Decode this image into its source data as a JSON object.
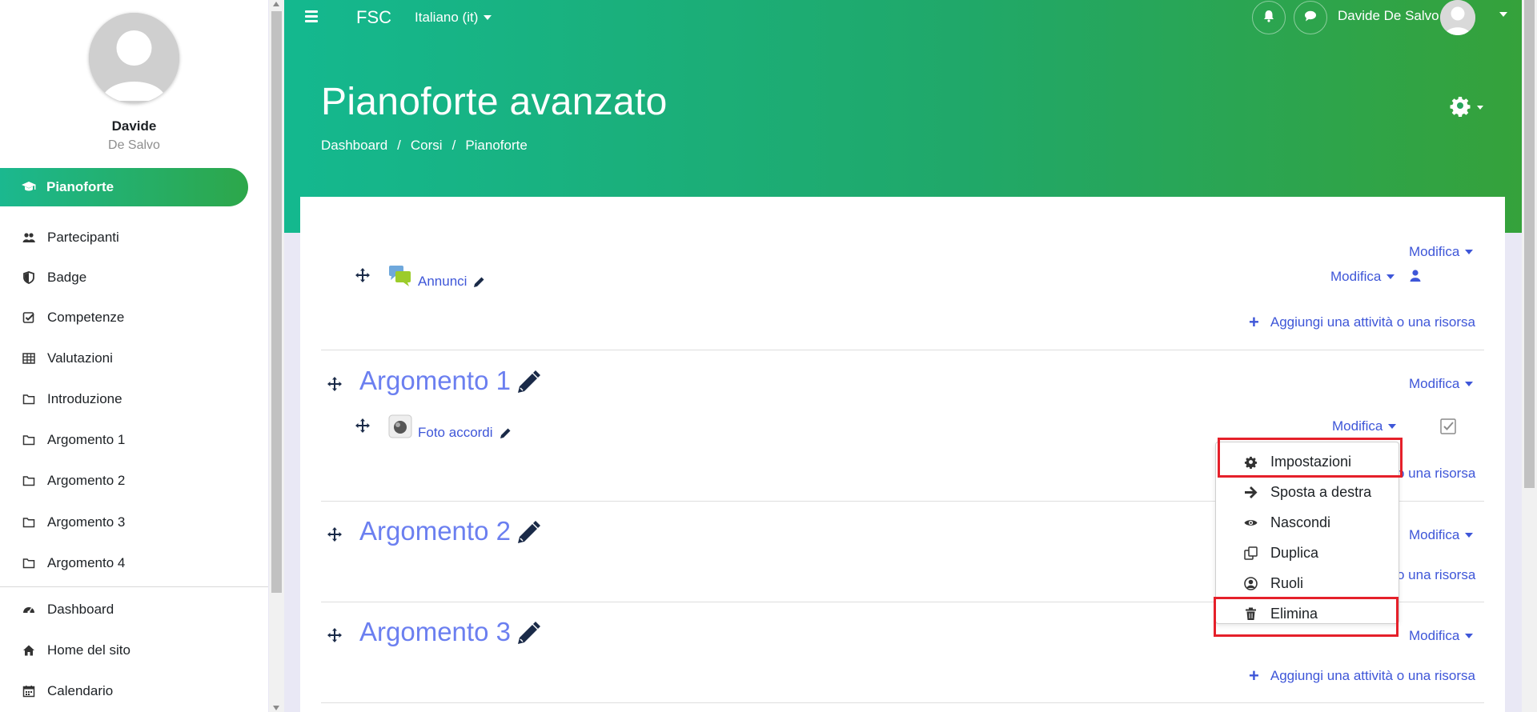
{
  "drawer": {
    "user_first": "Davide",
    "user_last": "De Salvo",
    "active_item": {
      "label": "Pianoforte",
      "icon": "graduation-cap-icon"
    },
    "items": [
      {
        "label": "Partecipanti",
        "icon": "users-icon"
      },
      {
        "label": "Badge",
        "icon": "shield-icon"
      },
      {
        "label": "Competenze",
        "icon": "checkbox-icon"
      },
      {
        "label": "Valutazioni",
        "icon": "table-icon"
      },
      {
        "label": "Introduzione",
        "icon": "folder-icon"
      },
      {
        "label": "Argomento 1",
        "icon": "folder-icon"
      },
      {
        "label": "Argomento 2",
        "icon": "folder-icon"
      },
      {
        "label": "Argomento 3",
        "icon": "folder-icon"
      },
      {
        "label": "Argomento 4",
        "icon": "folder-icon"
      }
    ],
    "bottom_items": [
      {
        "label": "Dashboard",
        "icon": "dashboard-icon"
      },
      {
        "label": "Home del sito",
        "icon": "home-icon"
      },
      {
        "label": "Calendario",
        "icon": "calendar-icon"
      }
    ]
  },
  "header": {
    "brand": "FSC",
    "language": "Italiano (it)",
    "user_name": "Davide De Salvo",
    "course_title": "Pianoforte avanzato",
    "breadcrumb": [
      "Dashboard",
      "Corsi",
      "Pianoforte"
    ],
    "breadcrumb_separator": "/"
  },
  "course": {
    "edit_label": "Modifica",
    "add_activity_label": "Aggiungi una attività o una risorsa",
    "add_activity_truncated": "o una risorsa",
    "general_activity": "Annunci",
    "sections": [
      {
        "title": "Argomento 1",
        "activity": "Foto accordi"
      },
      {
        "title": "Argomento 2"
      },
      {
        "title": "Argomento 3"
      }
    ]
  },
  "menu": {
    "items": [
      {
        "label": "Impostazioni",
        "icon": "gear-icon",
        "highlighted": true
      },
      {
        "label": "Sposta a destra",
        "icon": "arrow-right-icon",
        "highlighted": false
      },
      {
        "label": "Nascondi",
        "icon": "eye-icon",
        "highlighted": false
      },
      {
        "label": "Duplica",
        "icon": "copy-icon",
        "highlighted": false
      },
      {
        "label": "Ruoli",
        "icon": "user-circle-icon",
        "highlighted": false
      },
      {
        "label": "Elimina",
        "icon": "trash-icon",
        "highlighted": true
      }
    ]
  },
  "colors": {
    "accent_link": "#3e56d8",
    "section_title": "#6b7ff0",
    "header_gradient_start": "#14b88f",
    "header_gradient_end": "#35a23b",
    "highlight_red": "#e5202a"
  }
}
